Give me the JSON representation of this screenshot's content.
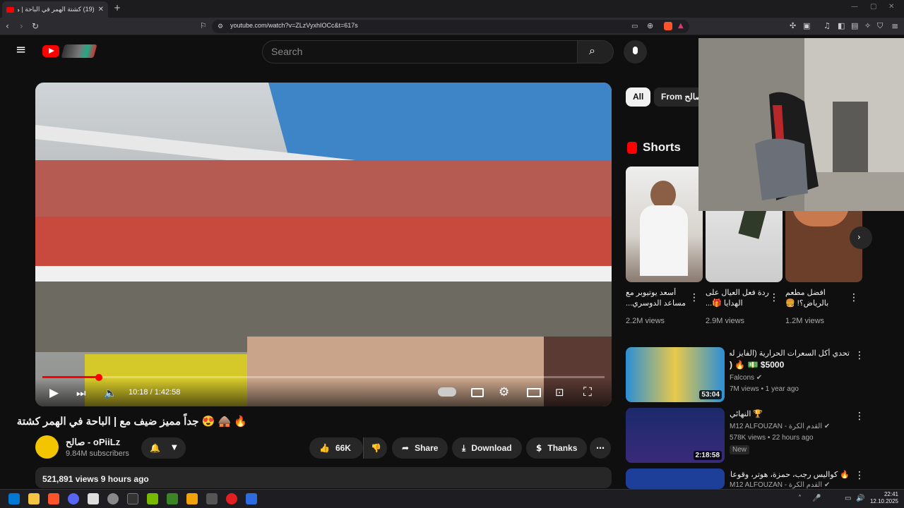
{
  "browser": {
    "tab_title": "(19) كشتة الهمر في الباحة | مع صـ...",
    "url": "youtube.com/watch?v=ZLzVyxhIOCc&t=617s"
  },
  "header": {
    "search_placeholder": "Search"
  },
  "player": {
    "time": "10:18 / 1:42:58",
    "progress_fraction": 0.1
  },
  "video": {
    "title": "🔥 🛖 😍 جداً مميز ضيف مع | الباحة في الهمر كشتة",
    "channel": "صالح - oPiiLz",
    "subscribers": "9.84M subscribers",
    "likes": "66K",
    "share": "Share",
    "download": "Download",
    "thanks": "Thanks",
    "views_time": "521,891 views  9 hours ago"
  },
  "sidebar": {
    "chips": [
      "All",
      "From صالح"
    ],
    "shorts_label": "Shorts",
    "shorts": [
      {
        "title": "أسعد يوتيوبر مع مساعد الدوسري...",
        "views": "2.2M views"
      },
      {
        "title": "ردة فعل العيال على الهدايا 🎁...",
        "views": "2.9M views"
      },
      {
        "title": "افضل مطعم بالرياض؟! 🍔",
        "views": "1.2M views"
      }
    ],
    "videos": [
      {
        "title": "تحدي أكل السعرات الحرارية (الفايز له",
        "title2": "$5000 💵 🔥 (",
        "channel": "Falcons ✔",
        "meta": "7M views • 1 year ago",
        "duration": "53:04",
        "badge": ""
      },
      {
        "title": "🏆 النهائي",
        "title2": "",
        "channel": "M12 ALFOUZAN - القدم الكرة ✔",
        "meta": "578K views • 22 hours ago",
        "duration": "2:18:58",
        "badge": "New"
      },
      {
        "title": "🔥 كواليس رجب، حمزة، هوتر، وقوعاني",
        "title2": "",
        "channel": "M12 ALFOUZAN - القدم الكرة ✔",
        "meta": "",
        "duration": "",
        "badge": ""
      }
    ]
  },
  "taskbar": {
    "time": "22:41",
    "date": "12.10.2025"
  },
  "colors": {
    "brand": "#ff0000",
    "bg": "#0f0f0f"
  }
}
